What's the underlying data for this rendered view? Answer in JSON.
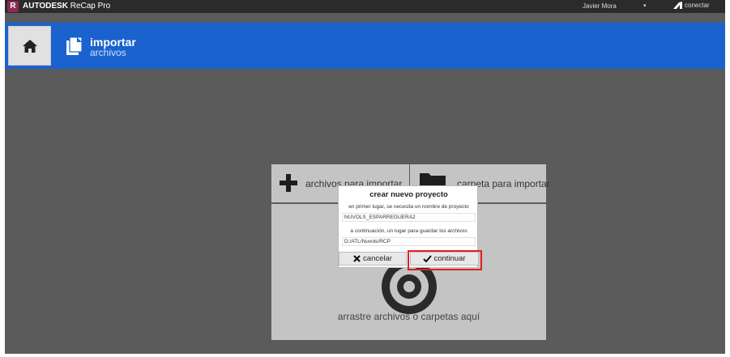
{
  "titlebar": {
    "logo_letter": "R",
    "brand": "AUTODESK",
    "product": " ReCap Pro",
    "user": "Javier Mora",
    "caret": "▾",
    "connect": "conectar"
  },
  "header": {
    "title": "importar",
    "subtitle": "archivos"
  },
  "tiles": {
    "files_label": "archivos para importar",
    "folder_label": "carpeta para importar",
    "drop_label": "arrastre archivos o carpetas aquí"
  },
  "dialog": {
    "title": "crear nuevo proyecto",
    "name_prompt": "en primer lugar, se necesita un nombre de proyecto",
    "name_value": "NUVOLS_ESPARREGUERA2",
    "path_prompt": "a continuación, un lugar para guardar los archivos",
    "path_value": "D:/ATL/Nuvols/RCP",
    "cancel_label": "cancelar",
    "continue_label": "continuar"
  },
  "icons": {
    "home": "home-icon",
    "import": "import-files-icon",
    "plus": "plus-icon",
    "folder": "folder-icon",
    "target": "target-icon",
    "connect": "autodesk-icon",
    "cancel": "x-icon",
    "continue": "check-icon"
  },
  "colors": {
    "header": "#1a62ce",
    "background": "#5b5b5b",
    "titlebar": "#2b2b2b",
    "highlight": "#e02020",
    "logo": "#8a2b54"
  }
}
